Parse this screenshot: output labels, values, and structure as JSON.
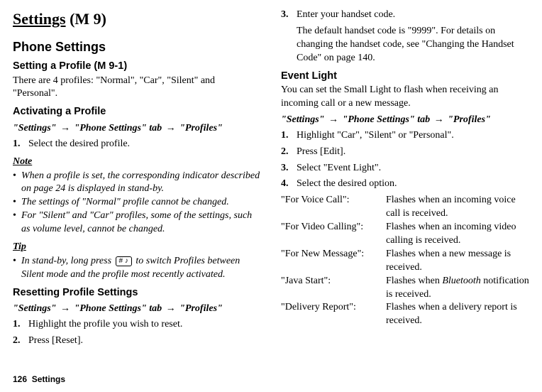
{
  "chapter": {
    "title": "Settings",
    "menu_num": "(M 9)"
  },
  "left": {
    "h2": "Phone Settings",
    "setting_profile": {
      "heading": "Setting a Profile",
      "menu_num": "(M 9-1)",
      "desc": "There are 4 profiles: \"Normal\", \"Car\", \"Silent\" and \"Personal\"."
    },
    "activating": {
      "heading": "Activating a Profile",
      "path_prefix": "\"Settings\"",
      "path_mid": "\"Phone Settings\" tab",
      "path_suffix": "\"Profiles\"",
      "steps": [
        "Select the desired profile."
      ]
    },
    "note_label": "Note",
    "notes": [
      "When a profile is set, the corresponding indicator described on page 24 is displayed in stand-by.",
      "The settings of \"Normal\" profile cannot be changed.",
      "For \"Silent\" and \"Car\" profiles, some of the settings, such as volume level, cannot be changed."
    ],
    "tip_label": "Tip",
    "tip_pre": "In stand-by, long press ",
    "tip_key": "# ♪",
    "tip_post": " to switch Profiles between Silent mode and the profile most recently activated.",
    "resetting": {
      "heading": "Resetting Profile Settings",
      "path_prefix": "\"Settings\"",
      "path_mid": "\"Phone Settings\" tab",
      "path_suffix": "\"Profiles\"",
      "steps": [
        "Highlight the profile you wish to reset.",
        "Press [Reset]."
      ]
    }
  },
  "right": {
    "continued_steps": {
      "start_num": 3,
      "step3_line1": "Enter your handset code.",
      "step3_para": "The default handset code is \"9999\". For details on changing the handset code, see \"Changing the Handset Code\" on page 140."
    },
    "event_light": {
      "heading": "Event Light",
      "desc": "You can set the Small Light to flash when receiving an incoming call or a new message.",
      "path_prefix": "\"Settings\"",
      "path_mid": "\"Phone Settings\" tab",
      "path_suffix": "\"Profiles\"",
      "steps": [
        "Highlight \"Car\", \"Silent\" or \"Personal\".",
        "Press [Edit].",
        "Select \"Event Light\".",
        "Select the desired option."
      ],
      "options": [
        {
          "key": "\"For Voice Call\":",
          "val": "Flashes when an incoming voice call is received."
        },
        {
          "key": "\"For Video Calling\":",
          "val": "Flashes when an incoming video calling is received."
        },
        {
          "key": "\"For New Message\":",
          "val": "Flashes when a new message is received."
        },
        {
          "key": "\"Java Start\":",
          "val_pre": "Flashes when ",
          "val_italic": "Bluetooth",
          "val_post": " notification is received."
        },
        {
          "key": "\"Delivery Report\":",
          "val": "Flashes when a delivery report is received."
        }
      ]
    }
  },
  "footer": {
    "page_num": "126",
    "section": "Settings"
  },
  "glyphs": {
    "arrow": "→",
    "bullet": "•"
  }
}
